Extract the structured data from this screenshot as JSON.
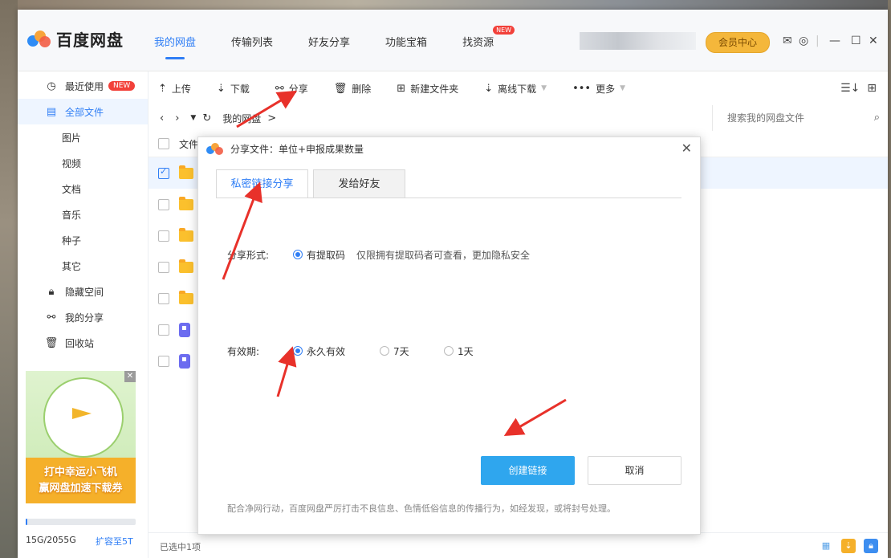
{
  "app": {
    "name": "百度网盘"
  },
  "nav": [
    {
      "label": "我的网盘",
      "active": true
    },
    {
      "label": "传输列表"
    },
    {
      "label": "好友分享"
    },
    {
      "label": "功能宝箱"
    },
    {
      "label": "找资源",
      "badge": "NEW"
    }
  ],
  "header": {
    "vip_label": "会员中心",
    "mail_icon": "mail-icon",
    "settings_icon": "settings-icon"
  },
  "sidebar": {
    "items": [
      {
        "label": "最近使用",
        "icon": "clock-icon",
        "badge": "NEW"
      },
      {
        "label": "全部文件",
        "icon": "doc-icon",
        "active": true
      },
      {
        "label": "图片"
      },
      {
        "label": "视频"
      },
      {
        "label": "文档"
      },
      {
        "label": "音乐"
      },
      {
        "label": "种子"
      },
      {
        "label": "其它"
      },
      {
        "label": "隐藏空间",
        "icon": "lock-icon"
      },
      {
        "label": "我的分享",
        "icon": "share-icon"
      },
      {
        "label": "回收站",
        "icon": "trash-icon"
      }
    ],
    "ad": {
      "line1": "打中幸运小飞机",
      "line2": "赢网盘加速下载券"
    },
    "storage": {
      "text": "15G/2055G",
      "used_fraction": 0.0073,
      "expand": "扩容至5T"
    }
  },
  "toolbar": {
    "upload": "上传",
    "download": "下载",
    "share": "分享",
    "delete": "删除",
    "new_folder": "新建文件夹",
    "offline": "离线下载",
    "more": "更多"
  },
  "path": {
    "current": "我的网盘",
    "sep": ">",
    "search_placeholder": "搜索我的网盘文件"
  },
  "filelist": {
    "header": "文件"
  },
  "status": {
    "selected": "已选中1项"
  },
  "dialog": {
    "title": "分享文件：单位+申报成果数量",
    "tabs": [
      "私密链接分享",
      "发给好友"
    ],
    "share_form_label": "分享形式:",
    "share_form_option": "有提取码",
    "share_form_hint": "仅限拥有提取码者可查看，更加隐私安全",
    "validity_label": "有效期:",
    "validity_options": [
      "永久有效",
      "7天",
      "1天"
    ],
    "create_btn": "创建链接",
    "cancel_btn": "取消",
    "notice": "配合净网行动，百度网盘严厉打击不良信息、色情低俗信息的传播行为，如经发现，或将封号处理。"
  },
  "colors": {
    "accent": "#2f7ef5",
    "vip": "#f4b73b",
    "primary_btn": "#2fa6ee",
    "arrow": "#e8312a"
  }
}
